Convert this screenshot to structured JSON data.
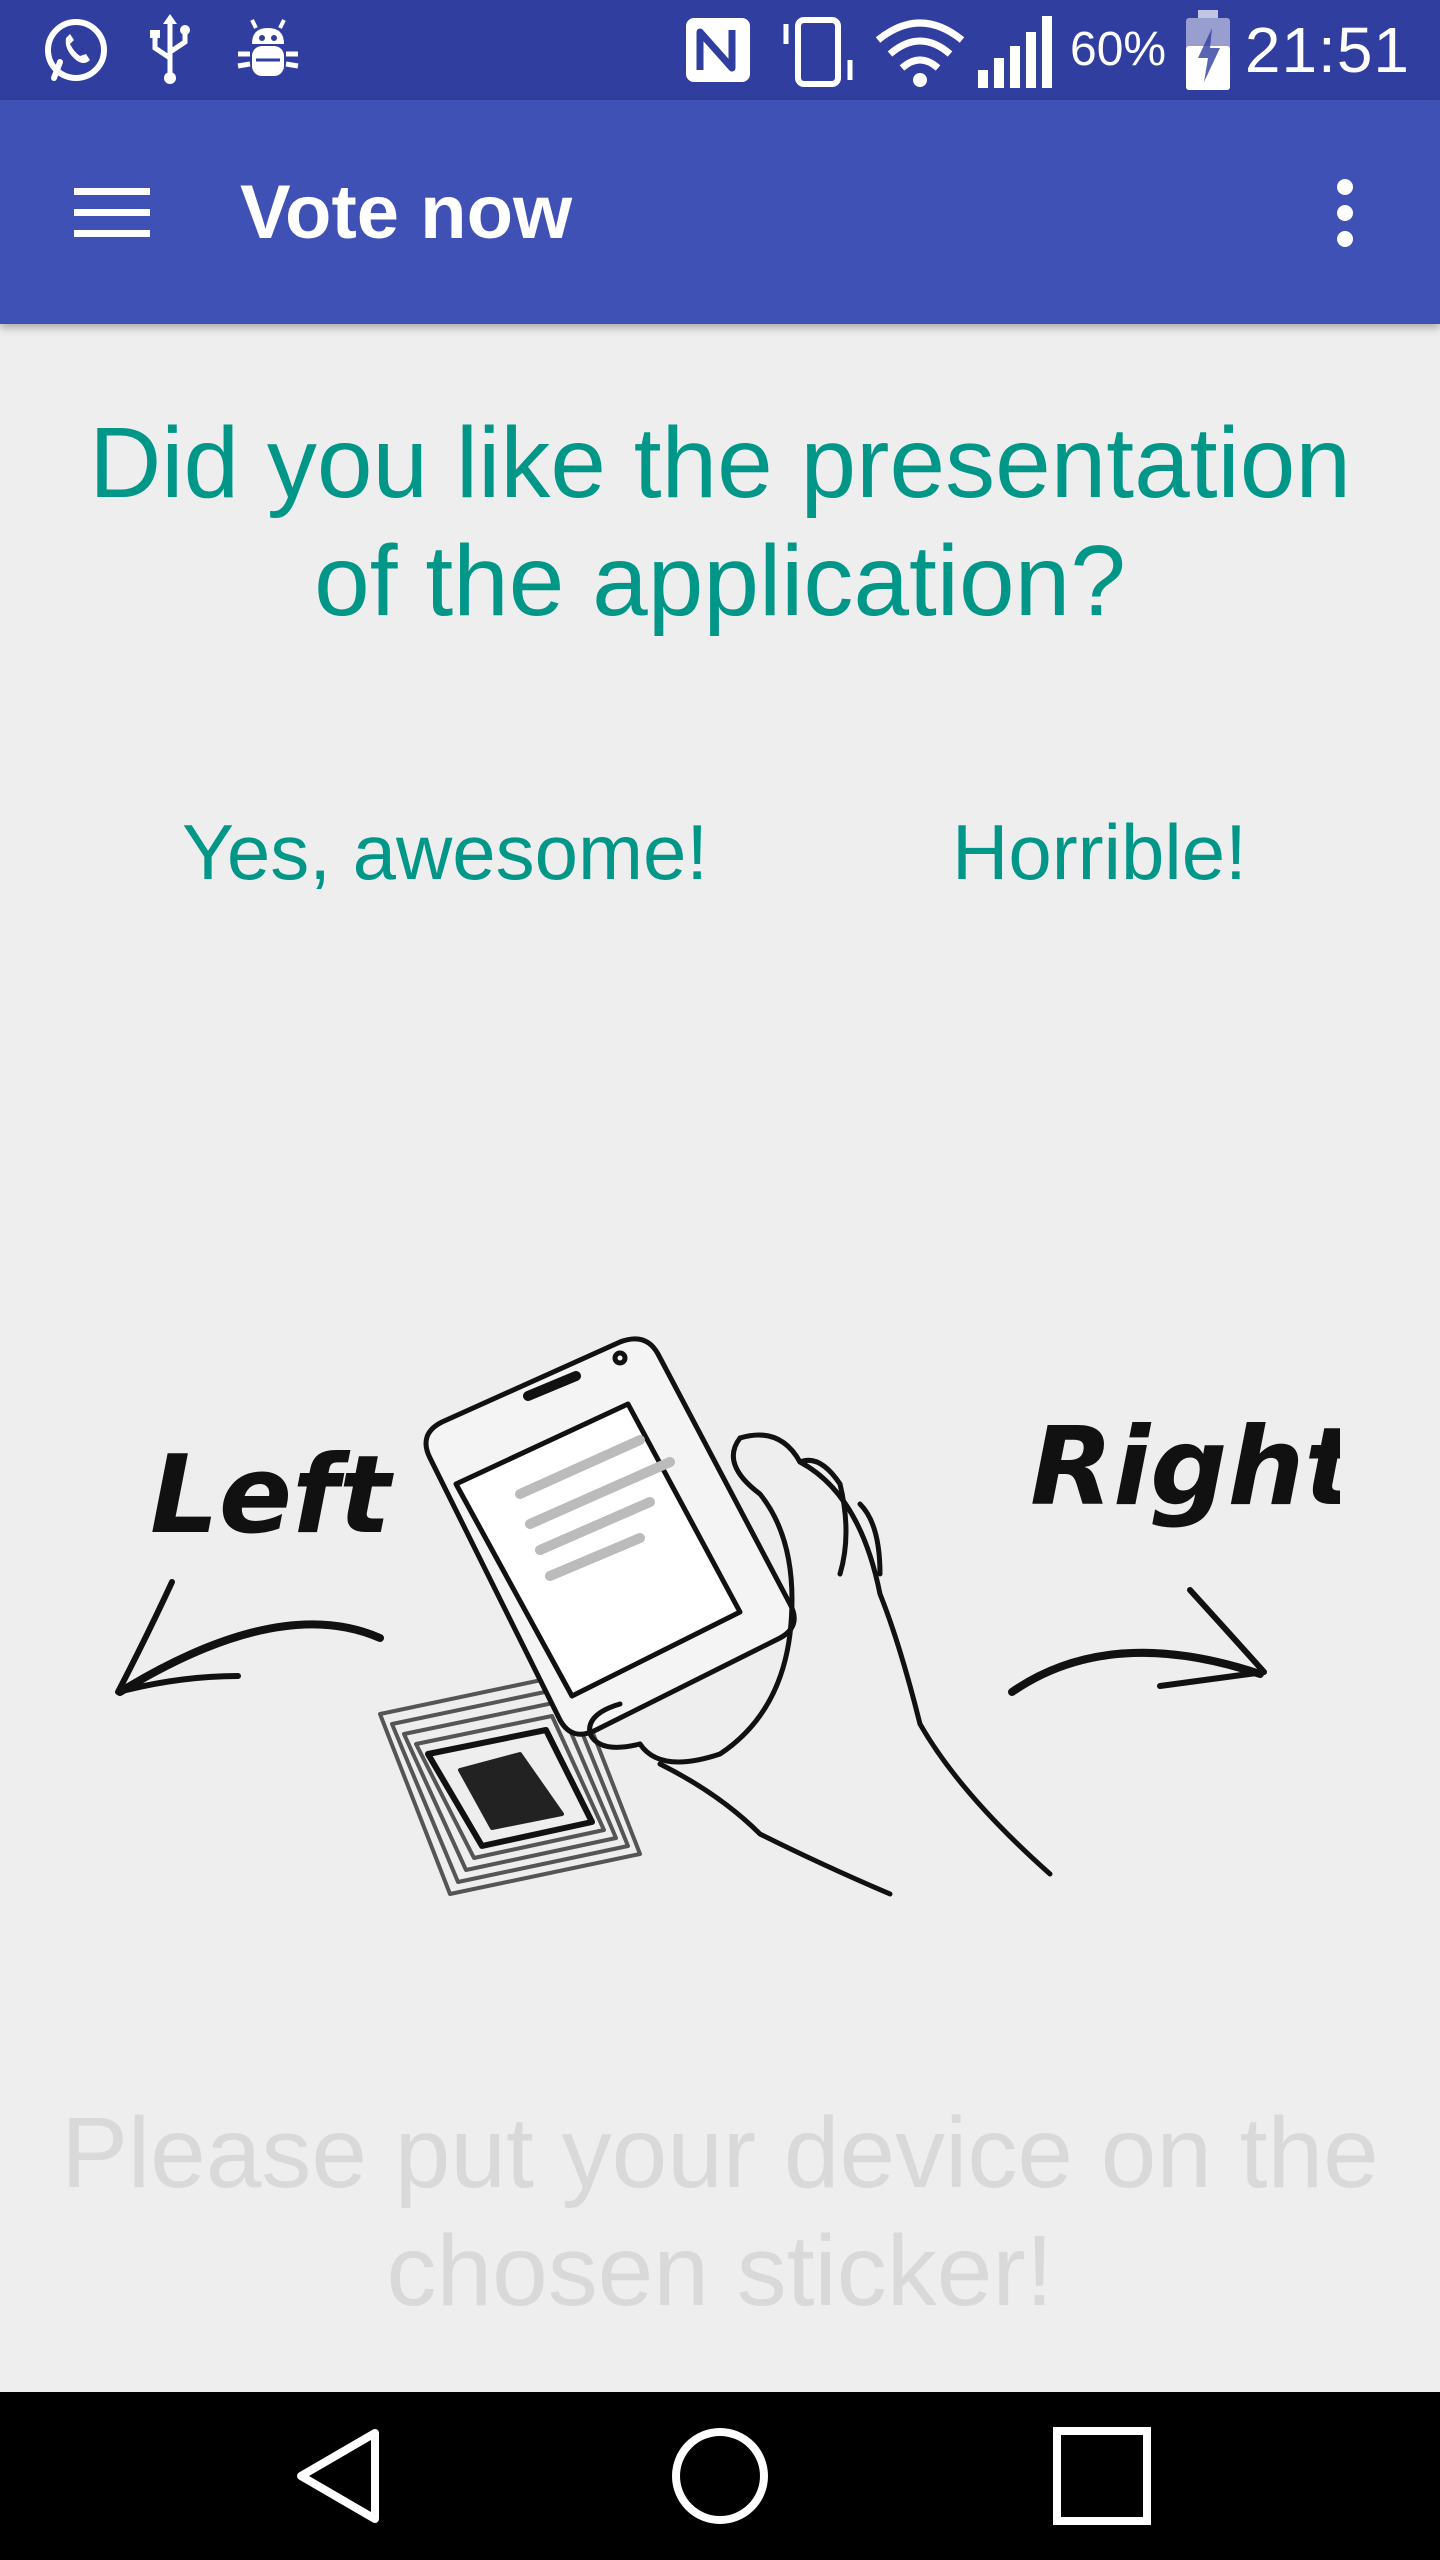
{
  "status_bar": {
    "icons": [
      "whatsapp-icon",
      "usb-icon",
      "android-debug-icon",
      "nfc-icon",
      "vibrate-icon",
      "wifi-icon",
      "signal-icon",
      "battery-charging-icon"
    ],
    "battery_percent": "60%",
    "time": "21:51"
  },
  "app_bar": {
    "title": "Vote now",
    "background_color": "#3f51b5"
  },
  "main": {
    "question": "Did you like the presentation of the application?",
    "option_left": "Yes, awesome!",
    "option_right": "Horrible!",
    "illustration": {
      "left_label": "Left",
      "right_label": "Right"
    },
    "instruction": "Please put your device on the chosen sticker!",
    "accent_color": "#009688"
  },
  "nav_bar": {
    "icons": [
      "back-icon",
      "home-icon",
      "recents-icon"
    ]
  }
}
